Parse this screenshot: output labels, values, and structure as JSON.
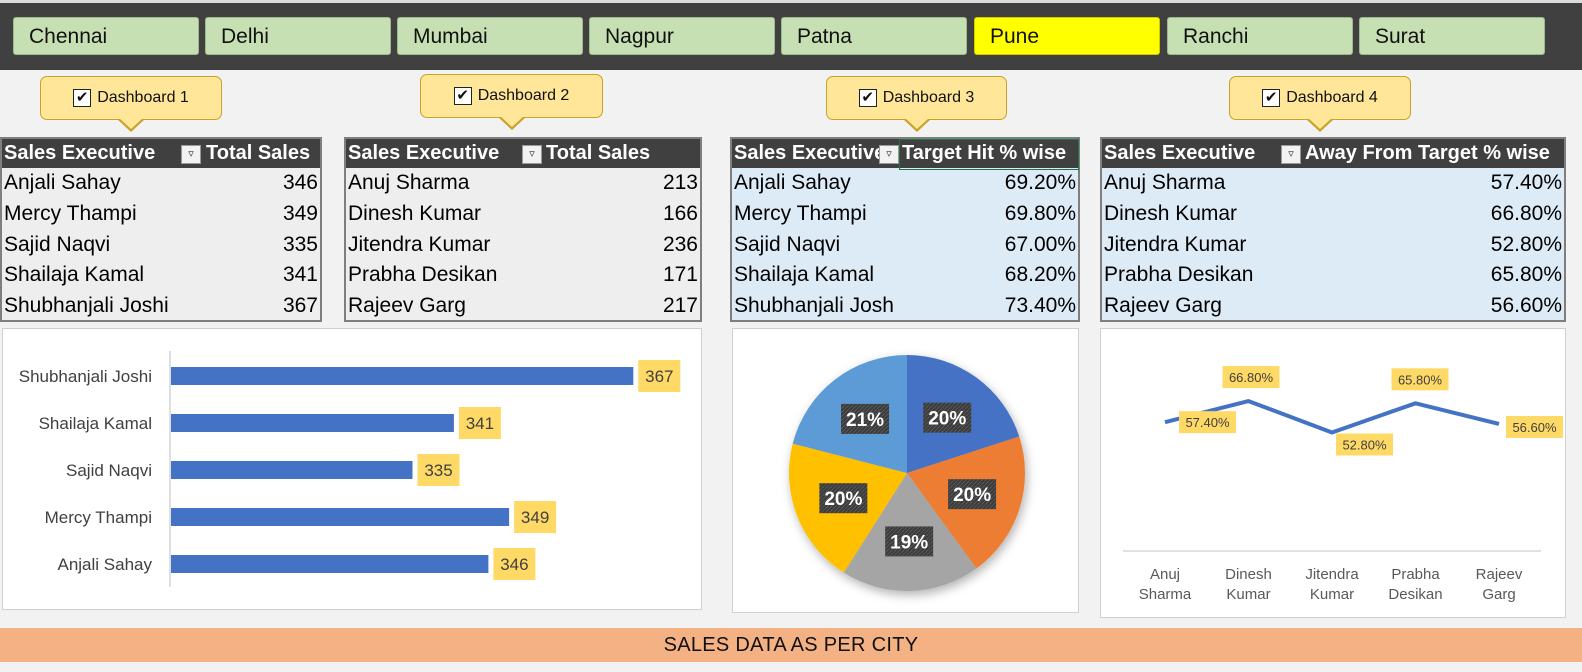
{
  "cities": [
    "Chennai",
    "Delhi",
    "Mumbai",
    "Nagpur",
    "Patna",
    "Pune",
    "Ranchi",
    "Surat"
  ],
  "selected_city": "Pune",
  "callouts": [
    {
      "label": "Dashboard 1",
      "checked": "✔"
    },
    {
      "label": "Dashboard 2",
      "checked": "✔"
    },
    {
      "label": "Dashboard 3",
      "checked": "✔"
    },
    {
      "label": "Dashboard 4",
      "checked": "✔"
    }
  ],
  "tables": [
    {
      "col1": "Sales Executive",
      "col2": "Total Sales",
      "rows": [
        {
          "name": "Anjali Sahay",
          "value": "346"
        },
        {
          "name": "Mercy Thampi",
          "value": "349"
        },
        {
          "name": "Sajid Naqvi",
          "value": "335"
        },
        {
          "name": "Shailaja Kamal",
          "value": "341"
        },
        {
          "name": "Shubhanjali Joshi",
          "value": "367"
        }
      ]
    },
    {
      "col1": "Sales Executive",
      "col2": "Total Sales",
      "rows": [
        {
          "name": "Anuj Sharma",
          "value": "213"
        },
        {
          "name": "Dinesh Kumar",
          "value": "166"
        },
        {
          "name": "Jitendra Kumar",
          "value": "236"
        },
        {
          "name": "Prabha Desikan",
          "value": "171"
        },
        {
          "name": "Rajeev Garg",
          "value": "217"
        }
      ]
    },
    {
      "col1": "Sales Executive",
      "col2": "Target Hit % wise",
      "rows": [
        {
          "name": "Anjali Sahay",
          "value": "69.20%"
        },
        {
          "name": "Mercy Thampi",
          "value": "69.80%"
        },
        {
          "name": "Sajid Naqvi",
          "value": "67.00%"
        },
        {
          "name": "Shailaja Kamal",
          "value": "68.20%"
        },
        {
          "name": "Shubhanjali Josh",
          "value": "73.40%"
        }
      ]
    },
    {
      "col1": "Sales Executive",
      "col2": "Away From Target % wise",
      "rows": [
        {
          "name": "Anuj Sharma",
          "value": "57.40%"
        },
        {
          "name": "Dinesh Kumar",
          "value": "66.80%"
        },
        {
          "name": "Jitendra Kumar",
          "value": "52.80%"
        },
        {
          "name": "Prabha Desikan",
          "value": "65.80%"
        },
        {
          "name": "Rajeev Garg",
          "value": "56.60%"
        }
      ]
    }
  ],
  "filter_icon": "filter-dropdown-icon",
  "footer": "SALES DATA AS PER CITY",
  "colors": {
    "city_button": "#c6e0b4",
    "city_selected": "#ffff00",
    "table_header": "#404040",
    "bar": "#4472c4",
    "data_label": "#ffd966",
    "footer": "#f4b183"
  },
  "chart_data": [
    {
      "type": "bar",
      "orientation": "horizontal",
      "categories": [
        "Shubhanjali Joshi",
        "Shailaja Kamal",
        "Sajid Naqvi",
        "Mercy Thampi",
        "Anjali Sahay"
      ],
      "values": [
        367,
        341,
        335,
        349,
        346
      ],
      "data_labels": [
        "367",
        "341",
        "335",
        "349",
        "346"
      ],
      "xlim": [
        300,
        370
      ],
      "color": "#4472c4"
    },
    {
      "type": "pie",
      "values": [
        20,
        20,
        19,
        20,
        21
      ],
      "labels": [
        "20%",
        "20%",
        "19%",
        "20%",
        "21%"
      ],
      "colors": [
        "#4472c4",
        "#ed7d31",
        "#a5a5a5",
        "#ffc000",
        "#5b9bd5"
      ]
    },
    {
      "type": "line",
      "categories": [
        "Anuj\nSharma",
        "Dinesh\nKumar",
        "Jitendra\nKumar",
        "Prabha\nDesikan",
        "Rajeev\nGarg"
      ],
      "values": [
        57.4,
        66.8,
        52.8,
        65.8,
        56.6
      ],
      "data_labels": [
        "57.40%",
        "66.80%",
        "52.80%",
        "65.80%",
        "56.60%"
      ],
      "ylim": [
        0,
        90
      ],
      "color": "#4472c4"
    }
  ]
}
